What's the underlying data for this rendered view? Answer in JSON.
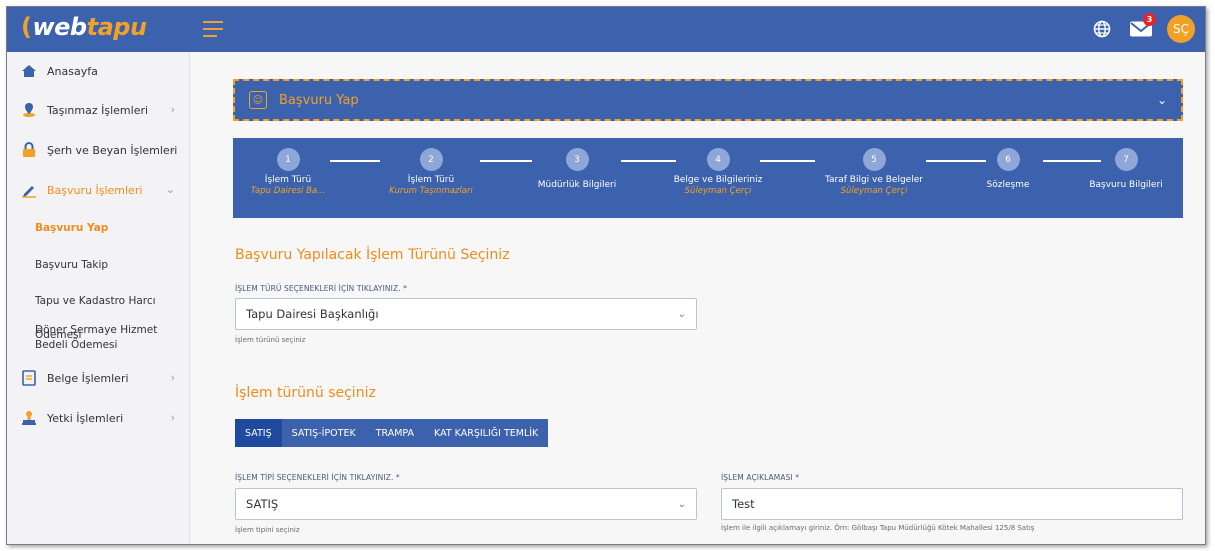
{
  "topbar": {
    "logo_part1": "web",
    "logo_part2": "tapu",
    "mail_badge": "3",
    "avatar_initials": "SÇ"
  },
  "sidebar": {
    "items": [
      {
        "label": "Anasayfa",
        "icon": "home-icon"
      },
      {
        "label": "Taşınmaz İşlemleri",
        "icon": "location-pin-icon"
      },
      {
        "label": "Şerh ve Beyan İşlemleri",
        "icon": "lock-icon"
      },
      {
        "label": "Başvuru İşlemleri",
        "icon": "pen-icon"
      },
      {
        "label": "Belge İşlemleri",
        "icon": "document-icon"
      },
      {
        "label": "Yetki İşlemleri",
        "icon": "stamp-icon"
      }
    ],
    "subitems": [
      {
        "label": "Başvuru Yap"
      },
      {
        "label": "Başvuru Takip"
      },
      {
        "label": "Tapu ve Kadastro Harcı Ödemesi"
      },
      {
        "label": "Döner Sermaye Hizmet Bedeli Ödemesi"
      }
    ]
  },
  "accordion": {
    "title": "Başvuru Yap"
  },
  "stepper": {
    "steps": [
      {
        "num": "1",
        "label": "İşlem Türü",
        "sub": "Tapu Dairesi Ba..."
      },
      {
        "num": "2",
        "label": "İşlem Türü",
        "sub": "Kurum Taşınmazları"
      },
      {
        "num": "3",
        "label": "Müdürlük Bilgileri",
        "sub": ""
      },
      {
        "num": "4",
        "label": "Belge ve Bilgileriniz",
        "sub": "Süleyman Çerçi"
      },
      {
        "num": "5",
        "label": "Taraf Bilgi ve Belgeler",
        "sub": "Süleyman Çerçi"
      },
      {
        "num": "6",
        "label": "Sözleşme",
        "sub": ""
      },
      {
        "num": "7",
        "label": "Başvuru Bilgileri",
        "sub": ""
      }
    ]
  },
  "form": {
    "section1_title": "Başvuru Yapılacak İşlem Türünü Seçiniz",
    "islem_turu_label": "İŞLEM TÜRÜ SEÇENEKLERİ İÇİN TIKLAYINIZ. *",
    "islem_turu_value": "Tapu Dairesi Başkanlığı",
    "islem_turu_hint": "İşlem türünü seçiniz",
    "section2_title": "İşlem türünü seçiniz",
    "tabs": [
      {
        "label": "SATIŞ"
      },
      {
        "label": "SATIŞ-İPOTEK"
      },
      {
        "label": "TRAMPA"
      },
      {
        "label": "KAT KARŞILIĞI TEMLİK"
      }
    ],
    "islem_tipi_label": "İŞLEM TİPİ SEÇENEKLERİ İÇİN TIKLAYINIZ. *",
    "islem_tipi_value": "SATIŞ",
    "islem_tipi_hint": "İşlem tipini seçiniz",
    "aciklama_label": "İŞLEM AÇIKLAMASI *",
    "aciklama_value": "Test",
    "aciklama_hint": "İşlem ile ilgili açıklamayı giriniz. Örn: Gölbaşı Tapu Müdürlüğü Kötek Mahallesi 125/8 Satış"
  }
}
